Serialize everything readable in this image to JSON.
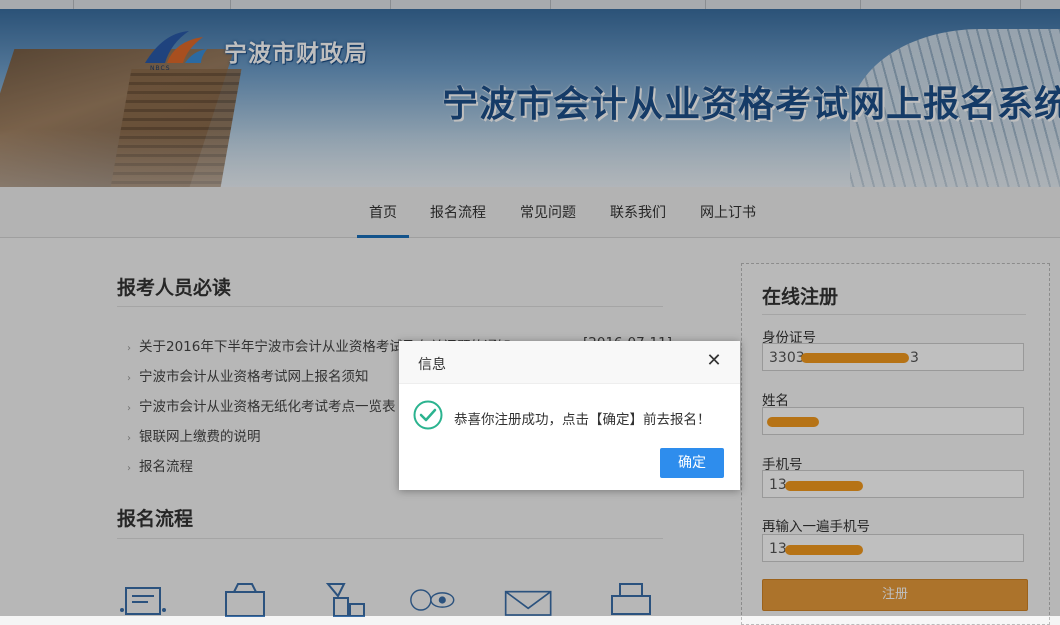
{
  "banner": {
    "bureau_name": "宁波市财政局",
    "logo_sub": "NBCS",
    "site_title": "宁波市会计从业资格考试网上报名系统"
  },
  "nav": {
    "items": [
      {
        "label": "首页",
        "active": true
      },
      {
        "label": "报名流程"
      },
      {
        "label": "常见问题"
      },
      {
        "label": "联系我们"
      },
      {
        "label": "网上订书"
      }
    ]
  },
  "notices": {
    "title": "报考人员必读",
    "items": [
      {
        "label": "关于2016年下半年宁波市会计从业资格考试及有关问题的通知"
      },
      {
        "label": "宁波市会计从业资格考试网上报名须知"
      },
      {
        "label": "宁波市会计从业资格无纸化考试考点一览表"
      },
      {
        "label": "银联网上缴费的说明"
      },
      {
        "label": "报名流程"
      }
    ],
    "first_date": "[2016-07-11]"
  },
  "process": {
    "title": "报名流程",
    "icons": [
      "form-icon",
      "computer-icon",
      "document-icon",
      "review-icon",
      "envelope-icon",
      "print-icon"
    ]
  },
  "register": {
    "title": "在线注册",
    "id_label": "身份证号",
    "id_value": "3303",
    "id_value_tail": "3",
    "name_label": "姓名",
    "phone_label": "手机号",
    "phone_value": "13",
    "phone2_label": "再输入一遍手机号",
    "phone2_value": "13",
    "submit_label": "注册"
  },
  "dialog": {
    "title": "信息",
    "close_glyph": "✕",
    "message": "恭喜你注册成功，点击【确定】前去报名！",
    "ok_label": "确定"
  },
  "colors": {
    "accent": "#1a6fba",
    "ok_button": "#2e8ded",
    "register_button": "#e69a3a",
    "success_icon": "#2bb38f"
  }
}
